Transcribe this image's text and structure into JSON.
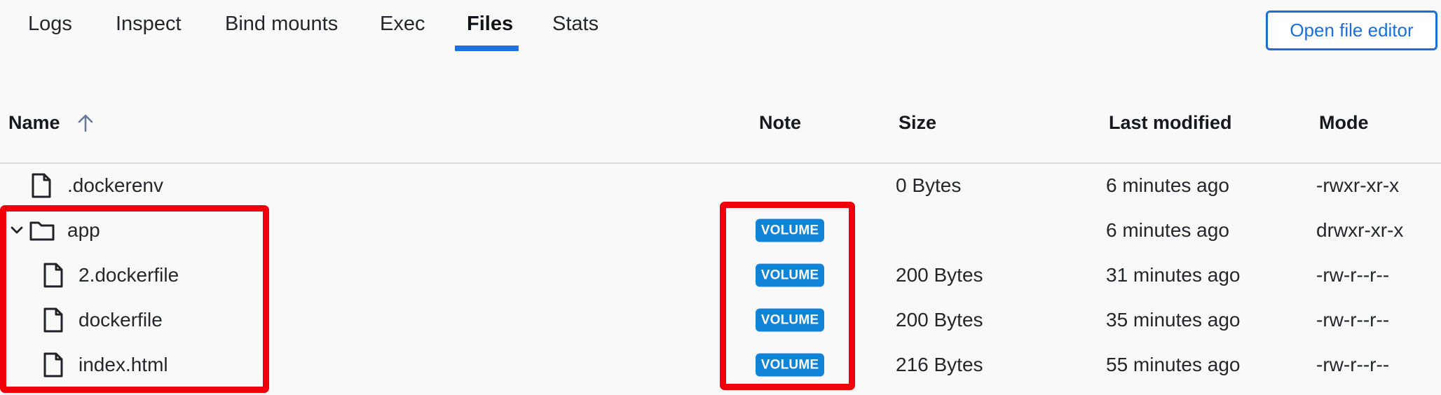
{
  "tabs": [
    {
      "label": "Logs",
      "active": false
    },
    {
      "label": "Inspect",
      "active": false
    },
    {
      "label": "Bind mounts",
      "active": false
    },
    {
      "label": "Exec",
      "active": false
    },
    {
      "label": "Files",
      "active": true
    },
    {
      "label": "Stats",
      "active": false
    }
  ],
  "actions": {
    "open_file_editor": "Open file editor"
  },
  "table": {
    "headers": {
      "name": "Name",
      "note": "Note",
      "size": "Size",
      "last_modified": "Last modified",
      "mode": "Mode"
    },
    "sort": {
      "column": "name",
      "direction": "ascending",
      "icon": "arrow-up-icon"
    },
    "rows": [
      {
        "type": "file",
        "name": ".dockerenv",
        "note": "",
        "size": "0 Bytes",
        "last_modified": "6 minutes ago",
        "mode": "-rwxr-xr-x"
      },
      {
        "type": "folder",
        "expanded": true,
        "name": "app",
        "note": "VOLUME",
        "size": "",
        "last_modified": "6 minutes ago",
        "mode": "drwxr-xr-x"
      },
      {
        "type": "file",
        "name": "2.dockerfile",
        "note": "VOLUME",
        "size": "200 Bytes",
        "last_modified": "31 minutes ago",
        "mode": "-rw-r--r--"
      },
      {
        "type": "file",
        "name": "dockerfile",
        "note": "VOLUME",
        "size": "200 Bytes",
        "last_modified": "35 minutes ago",
        "mode": "-rw-r--r--"
      },
      {
        "type": "file",
        "name": "index.html",
        "note": "VOLUME",
        "size": "216 Bytes",
        "last_modified": "55 minutes ago",
        "mode": "-rw-r--r--"
      }
    ]
  },
  "colors": {
    "accent": "#1f6fe5",
    "badge": "#1184d8",
    "highlight": "#f0000a"
  }
}
